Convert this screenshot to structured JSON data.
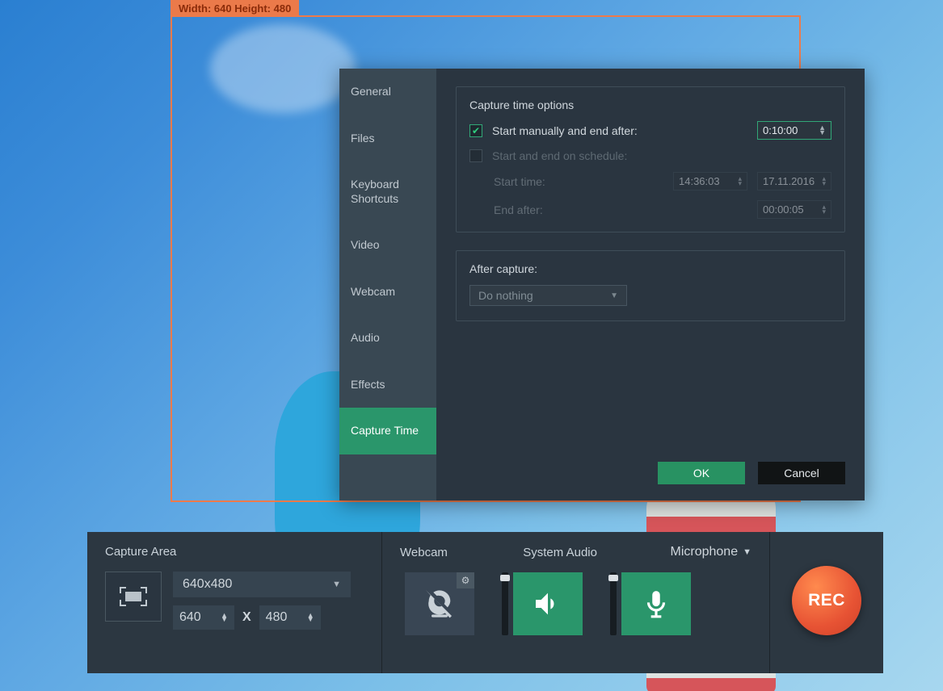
{
  "capture_overlay": {
    "label": "Width: 640 Height: 480"
  },
  "settings": {
    "tabs": [
      {
        "label": "General"
      },
      {
        "label": "Files"
      },
      {
        "label": "Keyboard Shortcuts"
      },
      {
        "label": "Video"
      },
      {
        "label": "Webcam"
      },
      {
        "label": "Audio"
      },
      {
        "label": "Effects"
      },
      {
        "label": "Capture Time"
      }
    ],
    "capture_time": {
      "title": "Capture time options",
      "manual_label": "Start manually and end after:",
      "manual_value": "0:10:00",
      "schedule_label": "Start and end on schedule:",
      "start_time_label": "Start time:",
      "start_time_value": "14:36:03",
      "start_date_value": "17.11.2016",
      "end_after_label": "End after:",
      "end_after_value": "00:00:05"
    },
    "after_capture": {
      "title": "After capture:",
      "selected": "Do nothing"
    },
    "actions": {
      "ok": "OK",
      "cancel": "Cancel"
    }
  },
  "toolbar": {
    "capture_area": {
      "title": "Capture Area",
      "preset": "640x480",
      "width": "640",
      "height": "480",
      "x": "X"
    },
    "media": {
      "webcam": "Webcam",
      "system_audio": "System Audio",
      "microphone": "Microphone"
    },
    "rec": "REC"
  },
  "icons": {
    "gear": "⚙",
    "triangle_down": "▼",
    "triangle_up": "▲"
  }
}
